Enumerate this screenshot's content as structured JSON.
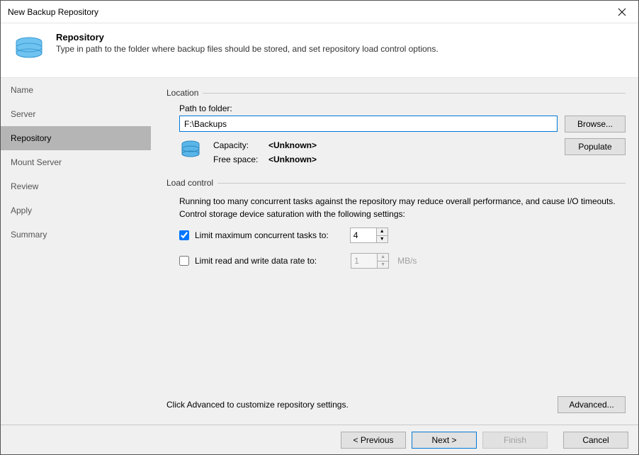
{
  "window": {
    "title": "New Backup Repository"
  },
  "header": {
    "title": "Repository",
    "subtitle": "Type in path to the folder where backup files should be stored, and set repository load control options."
  },
  "sidebar": {
    "items": [
      {
        "label": "Name"
      },
      {
        "label": "Server"
      },
      {
        "label": "Repository"
      },
      {
        "label": "Mount Server"
      },
      {
        "label": "Review"
      },
      {
        "label": "Apply"
      },
      {
        "label": "Summary"
      }
    ],
    "active_index": 2
  },
  "location": {
    "legend": "Location",
    "path_label": "Path to folder:",
    "path_value": "F:\\Backups",
    "browse_label": "Browse...",
    "populate_label": "Populate",
    "capacity_label": "Capacity:",
    "capacity_value": "<Unknown>",
    "freespace_label": "Free space:",
    "freespace_value": "<Unknown>"
  },
  "load_control": {
    "legend": "Load control",
    "description": "Running too many concurrent tasks against the repository may reduce overall performance, and cause I/O timeouts. Control storage device saturation with the following settings:",
    "limit_tasks_label": "Limit maximum concurrent tasks to:",
    "limit_tasks_checked": true,
    "limit_tasks_value": "4",
    "limit_rate_label": "Limit read and write data rate to:",
    "limit_rate_checked": false,
    "limit_rate_value": "1",
    "limit_rate_unit": "MB/s"
  },
  "footer": {
    "advanced_hint": "Click Advanced to customize repository settings.",
    "advanced_label": "Advanced..."
  },
  "buttons": {
    "previous": "< Previous",
    "next": "Next >",
    "finish": "Finish",
    "cancel": "Cancel"
  }
}
